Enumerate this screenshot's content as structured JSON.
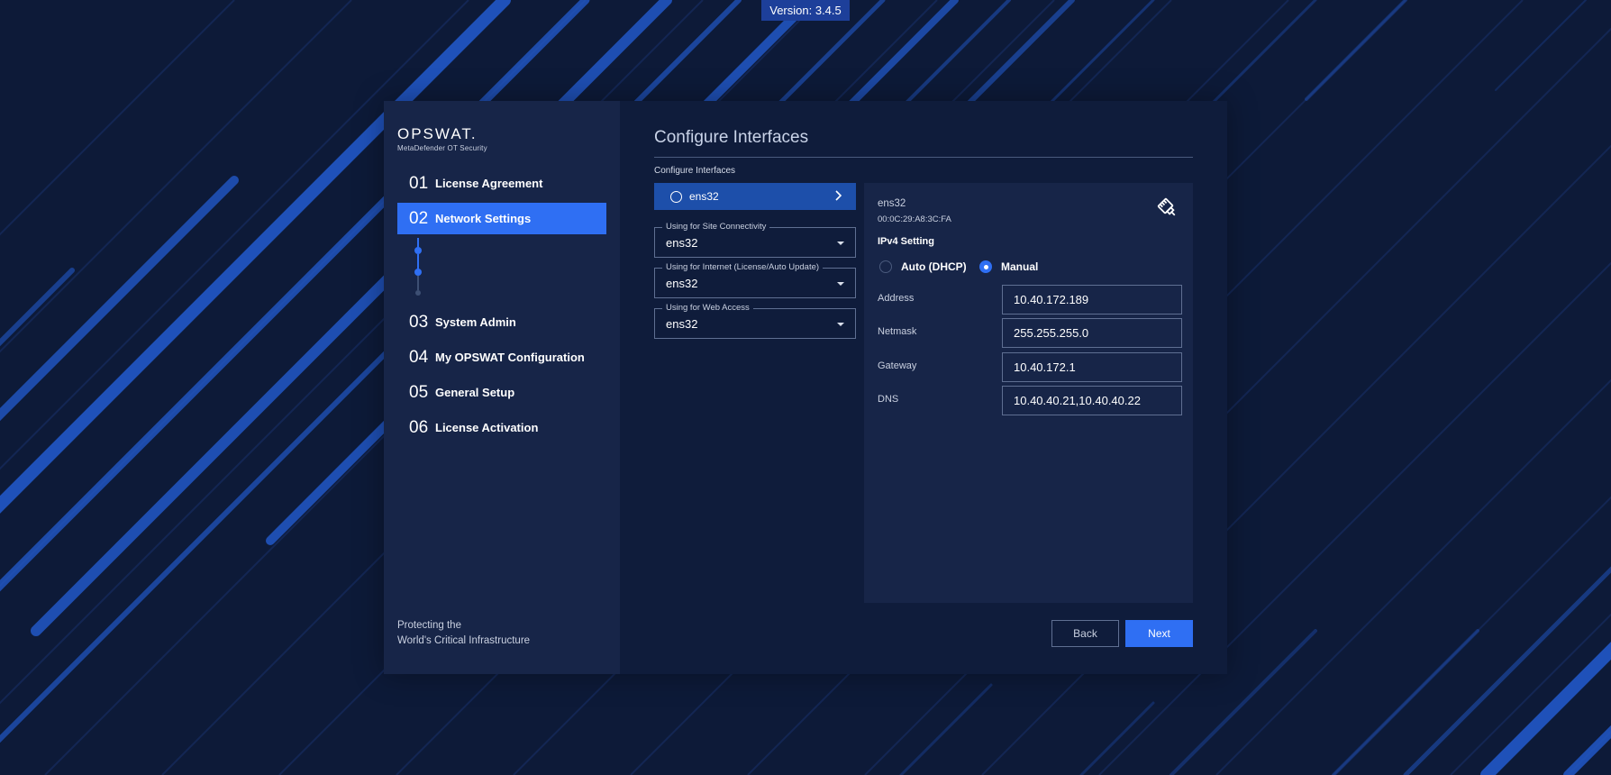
{
  "version_label": "Version: 3.4.5",
  "colors": {
    "background": "#0d1a38",
    "stripe": "#2258c7",
    "accent": "#2f6ff3",
    "panel": "#172548",
    "selected_interface": "#1d4faa"
  },
  "brand": {
    "logo": "OPSWAT.",
    "product": "MetaDefender OT Security",
    "tagline_line1": "Protecting the",
    "tagline_line2": "World's Critical Infrastructure"
  },
  "steps": [
    {
      "num": "01",
      "label": "License Agreement",
      "active": false
    },
    {
      "num": "02",
      "label": "Network Settings",
      "active": true
    },
    {
      "num": "03",
      "label": "System Admin",
      "active": false
    },
    {
      "num": "04",
      "label": "My OPSWAT Configuration",
      "active": false
    },
    {
      "num": "05",
      "label": "General Setup",
      "active": false
    },
    {
      "num": "06",
      "label": "License Activation",
      "active": false
    }
  ],
  "main": {
    "title": "Configure Interfaces",
    "section_label": "Configure Interfaces",
    "interface_list": [
      {
        "name": "ens32",
        "icon": "radio-unchecked-icon",
        "action_icon": "chevron-right-icon"
      }
    ],
    "usage_selects": [
      {
        "legend": "Using for Site Connectivity",
        "value": "ens32"
      },
      {
        "legend": "Using for Internet (License/Auto Update)",
        "value": "ens32"
      },
      {
        "legend": "Using for Web Access",
        "value": "ens32"
      }
    ]
  },
  "detail": {
    "name": "ens32",
    "mac": "00:0C:29:A8:3C:FA",
    "icon": "ethernet-icon",
    "ipv4_heading": "IPv4 Setting",
    "mode_options": [
      {
        "label": "Auto (DHCP)",
        "selected": false
      },
      {
        "label": "Manual",
        "selected": true
      }
    ],
    "fields": [
      {
        "label": "Address",
        "value": "10.40.172.189"
      },
      {
        "label": "Netmask",
        "value": "255.255.255.0"
      },
      {
        "label": "Gateway",
        "value": "10.40.172.1"
      },
      {
        "label": "DNS",
        "value": "10.40.40.21,10.40.40.22"
      }
    ]
  },
  "buttons": {
    "back": "Back",
    "next": "Next"
  }
}
